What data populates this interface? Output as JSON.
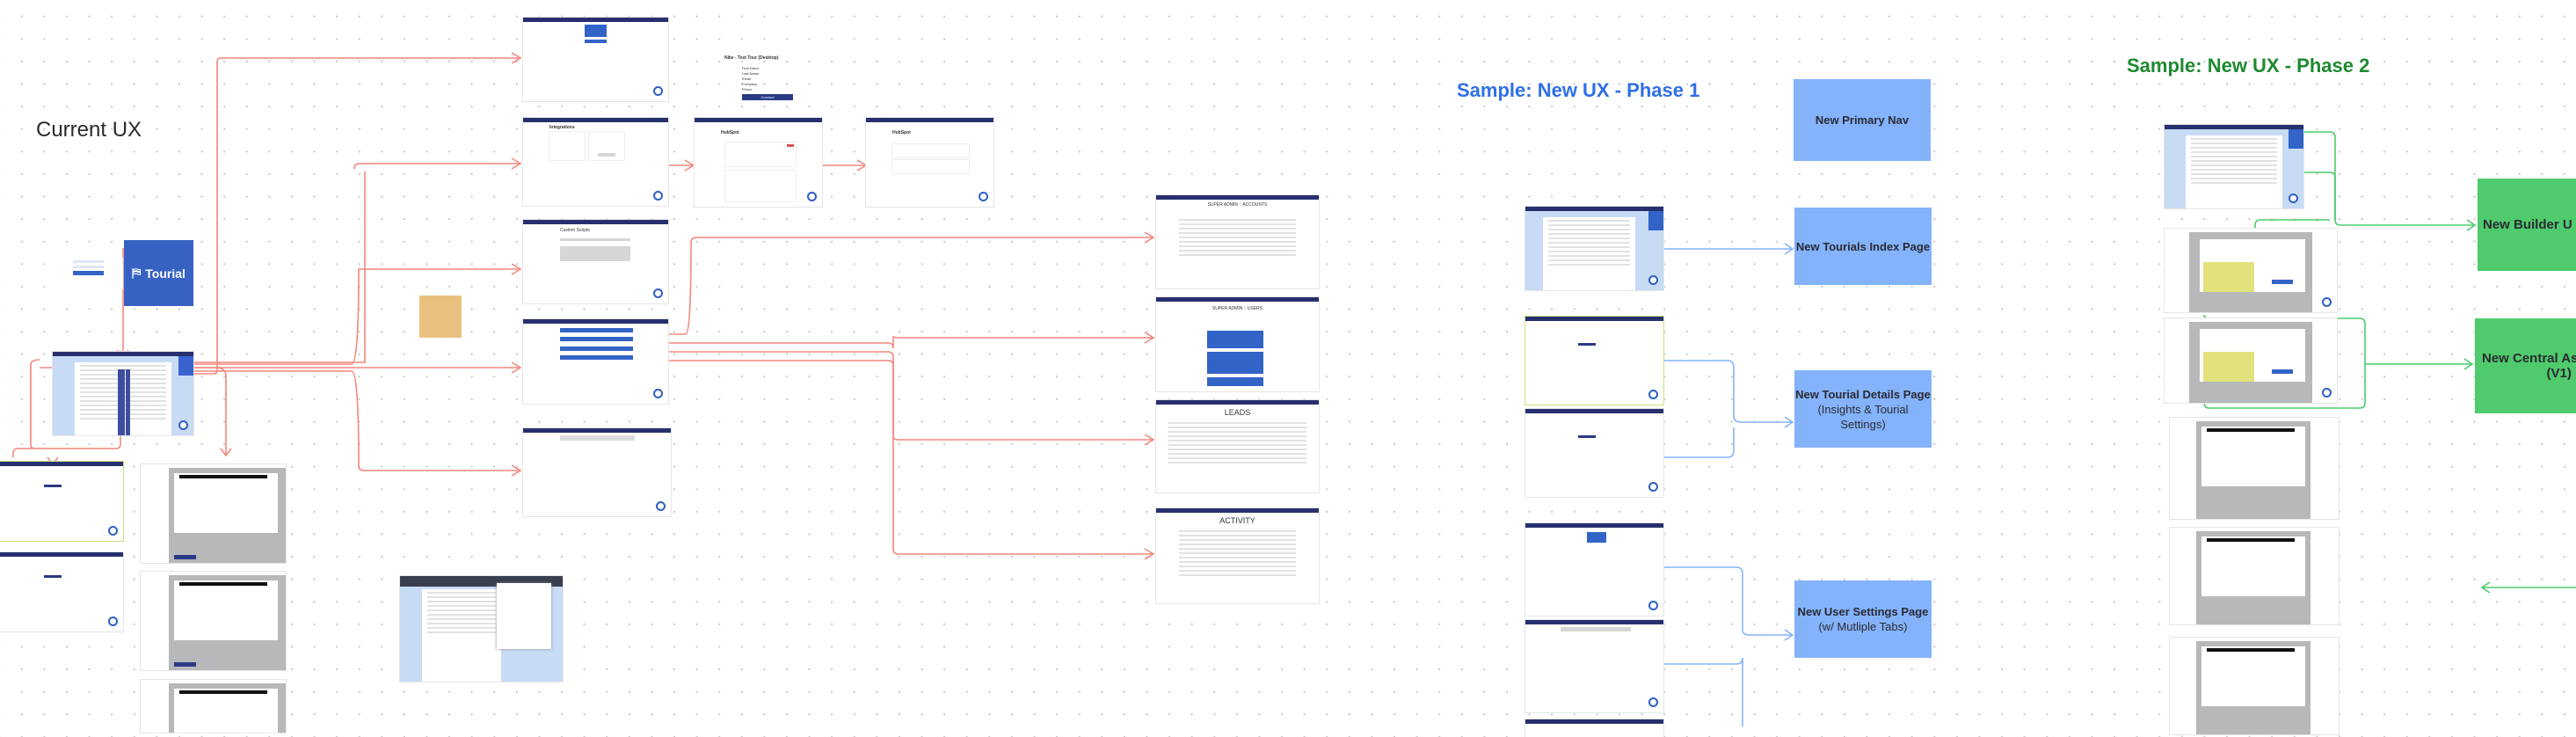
{
  "sections": {
    "current": {
      "title": "Current UX"
    },
    "phase1": {
      "title": "Sample: New UX - Phase 1",
      "color": "#2f6fe8"
    },
    "phase2": {
      "title": "Sample: New UX - Phase 2",
      "color": "#1e8a2f"
    }
  },
  "logo": {
    "text": "Tourial",
    "color": "#3762c4"
  },
  "screens": {
    "hubspot_form_title": "Nike - Test Tour (Desktop)",
    "hubspot_form_fields": [
      "First Name",
      "Last Name",
      "Email",
      "Company",
      "Phone"
    ],
    "hubspot_form_button": "Connect",
    "integrations_title": "Integrations",
    "hubspot_title": "HubSpot",
    "custom_scripts_title": "Custom Scripts",
    "accounts_title": "SUPER ADMIN :: ACCOUNTS",
    "users_title": "SUPER ADMIN :: USERS",
    "leads_title": "LEADS",
    "activity_title": "ACTIVITY"
  },
  "phase1_boxes": [
    {
      "title": "New Primary Nav",
      "subtitle": ""
    },
    {
      "title": "New Tourials Index Page",
      "subtitle": ""
    },
    {
      "title": "New Tourial Details Page",
      "subtitle": "(Insights & Tourial Settings)"
    },
    {
      "title": "New User Settings Page",
      "subtitle": "(w/ Mutliple Tabs)"
    }
  ],
  "phase2_boxes": [
    {
      "title": "New Builder U",
      "subtitle": ""
    },
    {
      "title": "New Central Ass",
      "subtitle": "(V1)"
    }
  ],
  "colors": {
    "connector_current": "#f4877d",
    "connector_phase1": "#86b4fb",
    "connector_phase2": "#4fcb6d",
    "box_phase1": "#84b3fb",
    "box_phase2": "#4fcb6d",
    "sticky_note": "#e9c17f"
  }
}
